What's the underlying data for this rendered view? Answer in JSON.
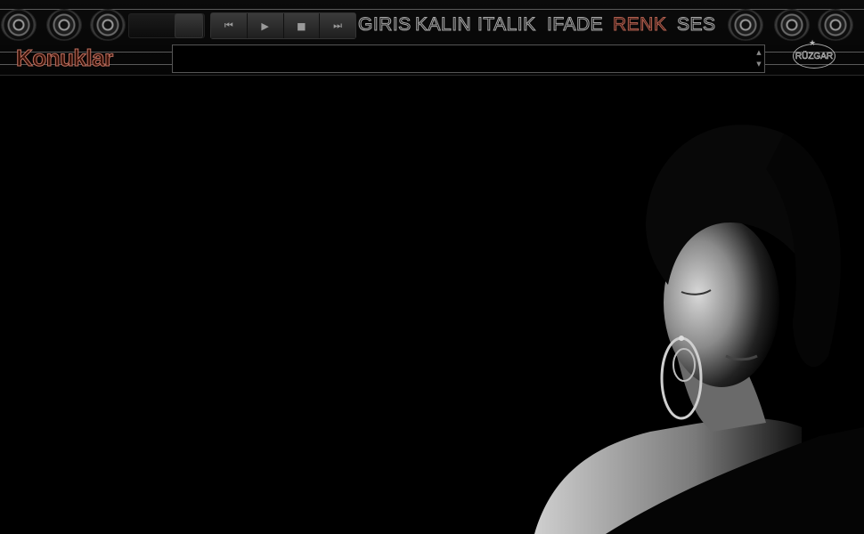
{
  "menu": [
    {
      "label": "GIRIS"
    },
    {
      "label": "KALIN"
    },
    {
      "label": "ITALIK"
    },
    {
      "label": "IFADE"
    },
    {
      "label": "RENK"
    },
    {
      "label": "SES"
    }
  ],
  "title": "Konuklar",
  "logo_text": "RÜZGAR",
  "transport": {
    "prev_icon": "skip-back-icon",
    "play_icon": "play-icon",
    "stop_icon": "stop-icon",
    "next_icon": "skip-forward-icon"
  },
  "message_input": {
    "value": "",
    "placeholder": ""
  },
  "colors": {
    "active_menu": "#b06050",
    "menu_outline": "#a8a8a8",
    "background": "#000000"
  }
}
